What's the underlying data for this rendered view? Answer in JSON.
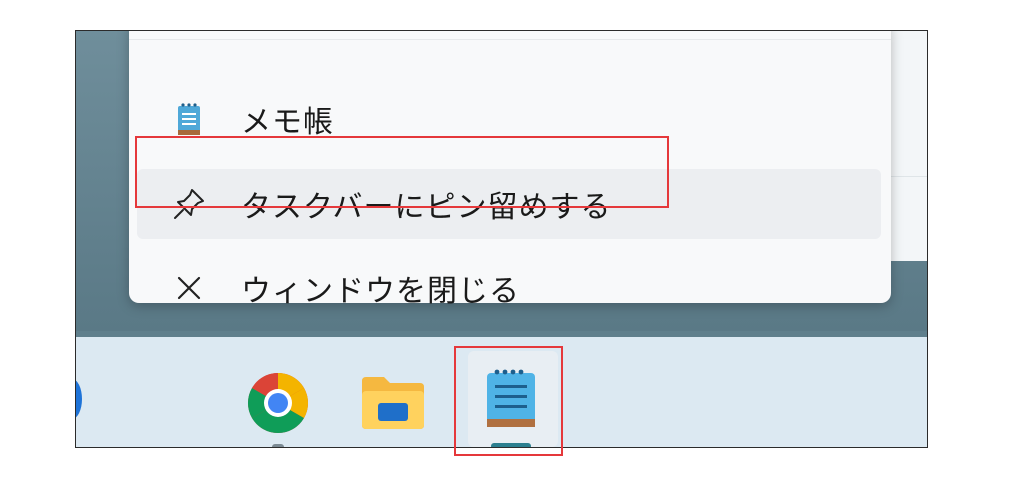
{
  "context_menu": {
    "items": [
      {
        "label": "メモ帳",
        "icon": "notepad-icon"
      },
      {
        "label": "タスクバーにピン留めする",
        "icon": "pin-icon"
      },
      {
        "label": "ウィンドウを閉じる",
        "icon": "close-icon"
      }
    ]
  },
  "taskbar": {
    "apps": [
      {
        "name": "chrome",
        "icon": "chrome-icon"
      },
      {
        "name": "file-explorer",
        "icon": "folder-icon"
      },
      {
        "name": "notepad",
        "icon": "notepad-icon"
      }
    ]
  },
  "colors": {
    "highlight": "#e5383b",
    "taskbar_bg": "#dce9f2",
    "menu_bg": "#f8f9fa"
  }
}
